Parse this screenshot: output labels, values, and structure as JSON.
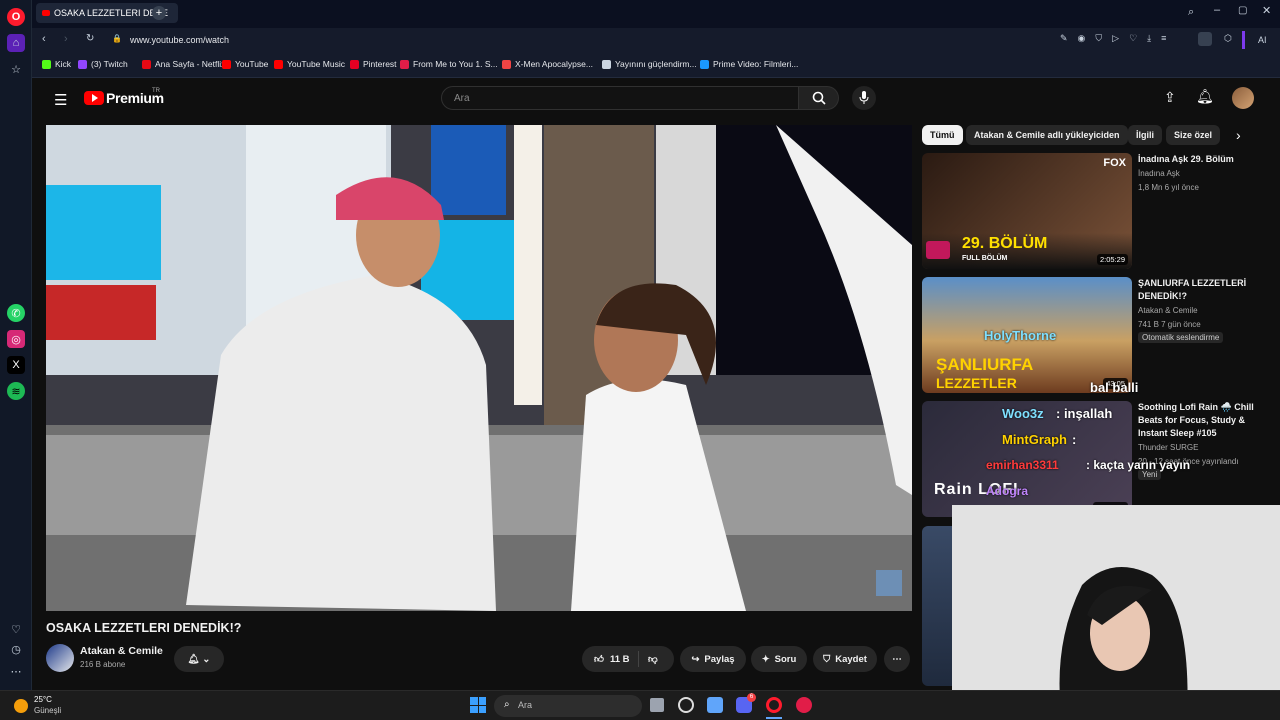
{
  "browser": {
    "tab_title": "OSAKA LEZZETLERI DENE",
    "url": "www.youtube.com/watch",
    "new_tab_symbol": "+",
    "ai_label": "AI",
    "bookmarks": [
      {
        "label": "Kick",
        "color": "#53fc18"
      },
      {
        "label": "(3) Twitch",
        "color": "#9146ff"
      },
      {
        "label": "Ana Sayfa - Netflix",
        "color": "#e50914"
      },
      {
        "label": "YouTube",
        "color": "#ff0000"
      },
      {
        "label": "YouTube Music",
        "color": "#ff0000"
      },
      {
        "label": "Pinterest",
        "color": "#e60023"
      },
      {
        "label": "From Me to You 1. S...",
        "color": "#e11d48"
      },
      {
        "label": "X-Men Apocalypse...",
        "color": "#ef4444"
      },
      {
        "label": "Yayınını güçlendirm...",
        "color": "#cbd5e1"
      },
      {
        "label": "Prime Video: Filmleri...",
        "color": "#1a98ff"
      }
    ]
  },
  "youtube": {
    "logo_text": "Premium",
    "logo_badge": "TR",
    "search_placeholder": "Ara",
    "video": {
      "title": "OSAKA LEZZETLERI DENEDİK!?",
      "channel": "Atakan & Cemile",
      "subscribers": "216 B abone",
      "likes": "11 B",
      "share_label": "Paylaş",
      "ask_label": "Soru",
      "save_label": "Kaydet"
    },
    "chips": [
      "Tümü",
      "Atakan & Cemile adlı yükleyiciden",
      "İlgili",
      "Size özel"
    ],
    "recommendations": [
      {
        "title": "İnadına Aşk 29. Bölüm",
        "channel": "İnadına Aşk",
        "meta": "1,8 Mn  6 yıl önce",
        "duration": "2:05:29",
        "thumb_text": "29. BÖLÜM",
        "thumb_sub": "FULL BÖLÜM",
        "thumb_brand": "FOX"
      },
      {
        "title": "ŞANLIURFA LEZZETLERİ DENEDİK!?",
        "channel": "Atakan & Cemile",
        "meta": "741 B  7 gün önce",
        "badge": "Otomatik seslendirme",
        "duration": "43:05",
        "thumb_text": "ŞANLIURFA",
        "thumb_sub": "LEZZETLER"
      },
      {
        "title": "Soothing Lofi Rain 🌧️ Chill Beats for Focus, Study & Instant Sleep #105",
        "channel": "Thunder SURGE",
        "meta": "20 - 12 saat önce yayınlandı",
        "badge": "Yeni",
        "duration": "10:05:51"
      }
    ]
  },
  "chat_overlay": [
    {
      "user": "HolyThorne",
      "msg": ""
    },
    {
      "user": "MintGraph",
      "msg": "bal balli"
    },
    {
      "user": "Woo3z",
      "msg": ": inşallah"
    },
    {
      "user": "MintGraph",
      "msg": ":"
    },
    {
      "user": "emirhan3311",
      "msg": ": kaçta yarın yayın"
    },
    {
      "user": "Adogra",
      "msg": ""
    }
  ],
  "stream_overlay_text": "Rain LOFI",
  "taskbar": {
    "temperature": "25°C",
    "weather": "Güneşli",
    "search_placeholder": "Ara",
    "discord_badge": "6"
  },
  "colors": {
    "yt_red": "#ff0000",
    "opera_red": "#ff1b2d",
    "chip_active_bg": "#f1f1f1",
    "chip_bg": "#272727"
  }
}
